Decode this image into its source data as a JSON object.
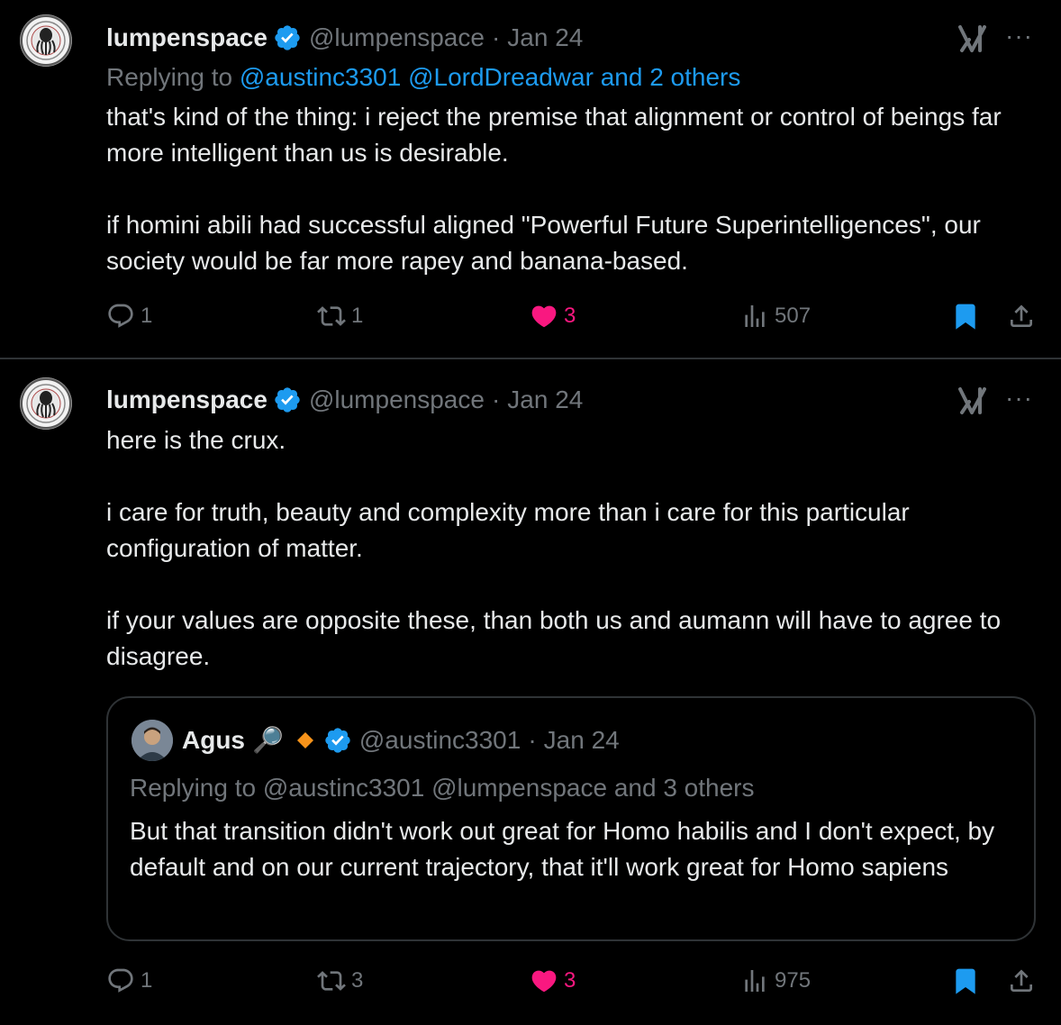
{
  "tweets": [
    {
      "author_name": "lumpenspace",
      "handle": "@lumpenspace",
      "separator": "·",
      "date": "Jan 24",
      "replying_prefix": "Replying to ",
      "replying_to": "@austinc3301 @LordDreadwar and 2 others",
      "text": "that's kind of the thing: i reject the premise that alignment or control of beings far more intelligent than us is desirable.\n\nif homini abili had successful aligned \"Powerful Future Superintelligences\", our society would be far more rapey and banana-based.",
      "more_label": "···",
      "replies": "1",
      "reposts": "1",
      "likes": "3",
      "views": "507"
    },
    {
      "author_name": "lumpenspace",
      "handle": "@lumpenspace",
      "separator": "·",
      "date": "Jan 24",
      "text": "here is the crux.\n\ni care for truth, beauty and complexity more than i care for this particular configuration of matter.\n\nif your values are opposite these, than both us and aumann will have to agree to disagree.",
      "more_label": "···",
      "replies": "1",
      "reposts": "3",
      "likes": "3",
      "views": "975",
      "quote": {
        "author_name": "Agus",
        "emoji": "🔎",
        "handle": "@austinc3301",
        "separator": "·",
        "date": "Jan 24",
        "replying_to": "Replying to @austinc3301 @lumpenspace and 3 others",
        "text": "But that transition didn't work out great for Homo habilis and I don't expect, by default and on our current trajectory, that it'll work great for Homo sapiens"
      }
    }
  ],
  "colors": {
    "background": "#000000",
    "text": "#e7e9ea",
    "muted": "#71767b",
    "link": "#1d9bf0",
    "like": "#f91880",
    "verified": "#1d9bf0",
    "bookmark": "#1d9bf0",
    "divider": "#2f3336"
  },
  "icons": [
    "verified-badge-icon",
    "grok-icon",
    "more-icon",
    "reply-icon",
    "repost-icon",
    "heart-icon",
    "views-icon",
    "bookmark-icon",
    "share-icon",
    "diamond-icon"
  ]
}
